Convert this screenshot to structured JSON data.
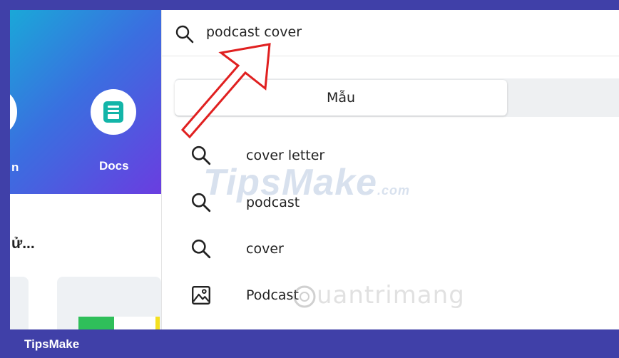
{
  "left_panel": {
    "partial_label": "n",
    "docs_label": "Docs",
    "section_heading": "ử..."
  },
  "search": {
    "query": "podcast cover",
    "tab_label": "Mẫu",
    "suggestions": [
      {
        "icon": "search-icon",
        "text": "cover letter"
      },
      {
        "icon": "search-icon",
        "text": "podcast"
      },
      {
        "icon": "search-icon",
        "text": "cover"
      },
      {
        "icon": "image-icon",
        "text": "Podcast"
      }
    ]
  },
  "watermarks": {
    "tipsmake": "TipsMake",
    "tipsmake_suffix": ".com",
    "quantrimang": "uantrimang"
  },
  "footer": {
    "label": "TipsMake"
  },
  "colors": {
    "frame_border": "#4040a8",
    "annotation_arrow": "#e02020",
    "docs_icon": "#13b5a8"
  }
}
